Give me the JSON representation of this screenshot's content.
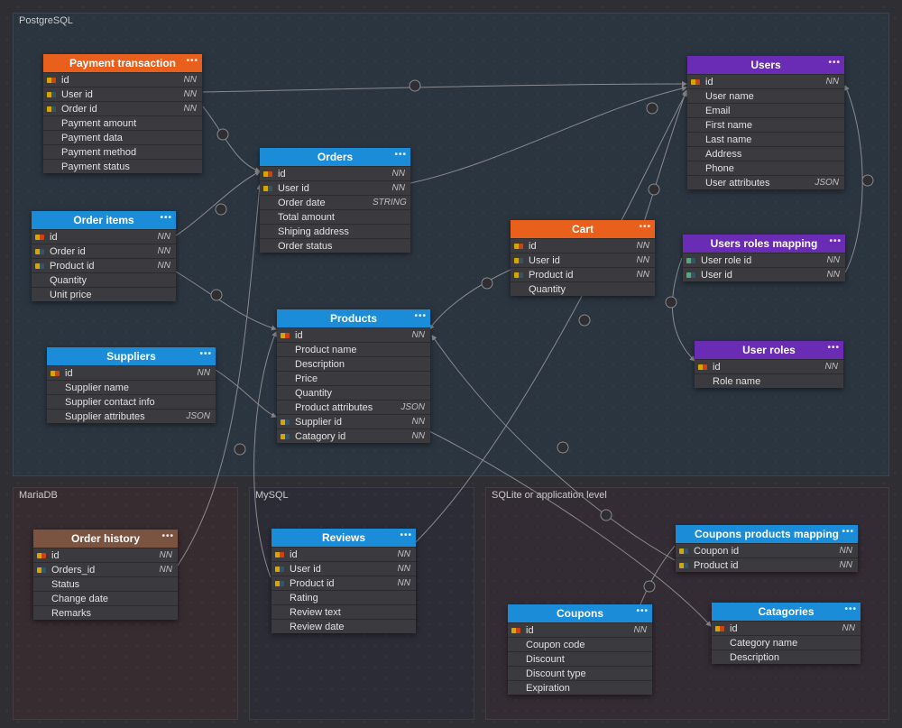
{
  "regions": {
    "pg": "PostgreSQL",
    "maria": "MariaDB",
    "mysql": "MySQL",
    "sqlite": "SQLite or application level"
  },
  "tables": {
    "payment": {
      "title": "Payment transaction",
      "rows": [
        {
          "icon": "pk",
          "name": "id",
          "meta": "NN"
        },
        {
          "icon": "fk",
          "name": "User id",
          "meta": "NN"
        },
        {
          "icon": "fk",
          "name": "Order id",
          "meta": "NN"
        },
        {
          "icon": "",
          "name": "Payment amount",
          "meta": ""
        },
        {
          "icon": "",
          "name": "Payment data",
          "meta": ""
        },
        {
          "icon": "",
          "name": "Payment method",
          "meta": ""
        },
        {
          "icon": "",
          "name": "Payment status",
          "meta": ""
        }
      ]
    },
    "orders": {
      "title": "Orders",
      "rows": [
        {
          "icon": "pk",
          "name": "id",
          "meta": "NN"
        },
        {
          "icon": "fk",
          "name": "User id",
          "meta": "NN"
        },
        {
          "icon": "",
          "name": "Order date",
          "meta": "STRING"
        },
        {
          "icon": "",
          "name": "Total amount",
          "meta": ""
        },
        {
          "icon": "",
          "name": "Shiping address",
          "meta": ""
        },
        {
          "icon": "",
          "name": "Order status",
          "meta": ""
        }
      ]
    },
    "orderitems": {
      "title": "Order items",
      "rows": [
        {
          "icon": "pk",
          "name": "id",
          "meta": "NN"
        },
        {
          "icon": "fk",
          "name": "Order id",
          "meta": "NN"
        },
        {
          "icon": "fk",
          "name": "Product id",
          "meta": "NN"
        },
        {
          "icon": "",
          "name": "Quantity",
          "meta": ""
        },
        {
          "icon": "",
          "name": "Unit price",
          "meta": ""
        }
      ]
    },
    "cart": {
      "title": "Cart",
      "rows": [
        {
          "icon": "pk",
          "name": "id",
          "meta": "NN"
        },
        {
          "icon": "fk",
          "name": "User id",
          "meta": "NN"
        },
        {
          "icon": "fk",
          "name": "Product id",
          "meta": "NN"
        },
        {
          "icon": "",
          "name": "Quantity",
          "meta": ""
        }
      ]
    },
    "users": {
      "title": "Users",
      "rows": [
        {
          "icon": "pk",
          "name": "id",
          "meta": "NN"
        },
        {
          "icon": "",
          "name": "User name",
          "meta": ""
        },
        {
          "icon": "",
          "name": "Email",
          "meta": ""
        },
        {
          "icon": "",
          "name": "First name",
          "meta": ""
        },
        {
          "icon": "",
          "name": "Last name",
          "meta": ""
        },
        {
          "icon": "",
          "name": "Address",
          "meta": ""
        },
        {
          "icon": "",
          "name": "Phone",
          "meta": ""
        },
        {
          "icon": "",
          "name": "User attributes",
          "meta": "JSON"
        }
      ]
    },
    "usersroles": {
      "title": "Users roles mapping",
      "rows": [
        {
          "icon": "fk2",
          "name": "User role id",
          "meta": "NN"
        },
        {
          "icon": "fk2",
          "name": "User id",
          "meta": "NN"
        }
      ]
    },
    "userroles": {
      "title": "User roles",
      "rows": [
        {
          "icon": "pk",
          "name": "id",
          "meta": "NN"
        },
        {
          "icon": "",
          "name": "Role name",
          "meta": ""
        }
      ]
    },
    "suppliers": {
      "title": "Suppliers",
      "rows": [
        {
          "icon": "pk",
          "name": "id",
          "meta": "NN"
        },
        {
          "icon": "",
          "name": "Supplier name",
          "meta": ""
        },
        {
          "icon": "",
          "name": "Supplier contact info",
          "meta": ""
        },
        {
          "icon": "",
          "name": "Supplier attributes",
          "meta": "JSON"
        }
      ]
    },
    "products": {
      "title": "Products",
      "rows": [
        {
          "icon": "pk",
          "name": "id",
          "meta": "NN"
        },
        {
          "icon": "",
          "name": "Product name",
          "meta": ""
        },
        {
          "icon": "",
          "name": "Description",
          "meta": ""
        },
        {
          "icon": "",
          "name": "Price",
          "meta": ""
        },
        {
          "icon": "",
          "name": "Quantity",
          "meta": ""
        },
        {
          "icon": "",
          "name": "Product attributes",
          "meta": "JSON"
        },
        {
          "icon": "fk",
          "name": "Supplier id",
          "meta": "NN"
        },
        {
          "icon": "fk",
          "name": "Catagory id",
          "meta": "NN"
        }
      ]
    },
    "orderhistory": {
      "title": "Order history",
      "rows": [
        {
          "icon": "pk",
          "name": "id",
          "meta": "NN"
        },
        {
          "icon": "fk",
          "name": "Orders_id",
          "meta": "NN"
        },
        {
          "icon": "",
          "name": "Status",
          "meta": ""
        },
        {
          "icon": "",
          "name": "Change date",
          "meta": ""
        },
        {
          "icon": "",
          "name": "Remarks",
          "meta": ""
        }
      ]
    },
    "reviews": {
      "title": "Reviews",
      "rows": [
        {
          "icon": "pk",
          "name": "id",
          "meta": "NN"
        },
        {
          "icon": "fk",
          "name": "User id",
          "meta": "NN"
        },
        {
          "icon": "fk",
          "name": "Product id",
          "meta": "NN"
        },
        {
          "icon": "",
          "name": "Rating",
          "meta": ""
        },
        {
          "icon": "",
          "name": "Review text",
          "meta": ""
        },
        {
          "icon": "",
          "name": "Review date",
          "meta": ""
        }
      ]
    },
    "coupons": {
      "title": "Coupons",
      "rows": [
        {
          "icon": "pk",
          "name": "id",
          "meta": "NN"
        },
        {
          "icon": "",
          "name": "Coupon code",
          "meta": ""
        },
        {
          "icon": "",
          "name": "Discount",
          "meta": ""
        },
        {
          "icon": "",
          "name": "Discount type",
          "meta": ""
        },
        {
          "icon": "",
          "name": "Expiration",
          "meta": ""
        }
      ]
    },
    "couponsmap": {
      "title": "Coupons products mapping",
      "rows": [
        {
          "icon": "fk",
          "name": "Coupon id",
          "meta": "NN"
        },
        {
          "icon": "fk",
          "name": "Product id",
          "meta": "NN"
        }
      ]
    },
    "categories": {
      "title": "Catagories",
      "rows": [
        {
          "icon": "pk",
          "name": "id",
          "meta": "NN"
        },
        {
          "icon": "",
          "name": "Category name",
          "meta": ""
        },
        {
          "icon": "",
          "name": "Description",
          "meta": ""
        }
      ]
    }
  }
}
